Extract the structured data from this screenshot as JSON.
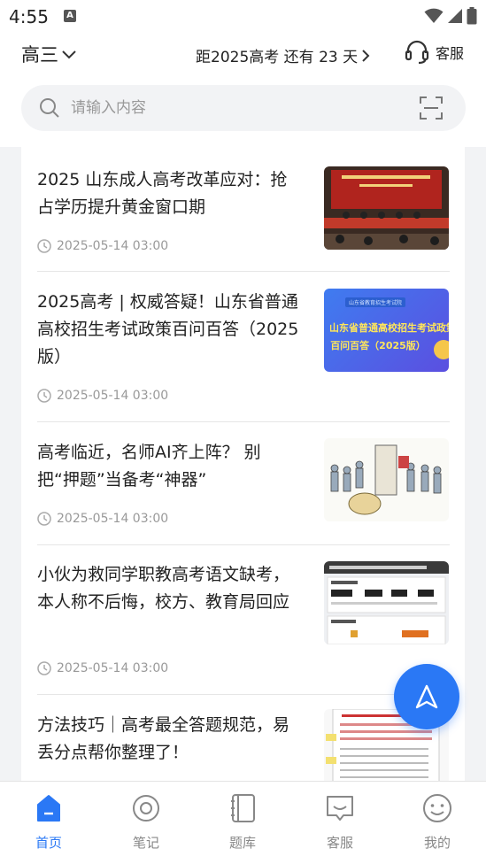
{
  "status": {
    "time": "4:55",
    "notif_letter": "A"
  },
  "header": {
    "grade": "高三",
    "countdown": "距2025高考 还有 23 天",
    "service_label": "客服"
  },
  "search": {
    "placeholder": "请输入内容"
  },
  "articles": [
    {
      "title": "2025 山东成人高考改革应对：抢占学历提升黄金窗口期",
      "date": "2025-05-14 03:00",
      "thumb": "meeting-photo"
    },
    {
      "title": "2025高考 | 权威答疑！山东省普通高校招生考试政策百问百答（2025版）",
      "date": "2025-05-14 03:00",
      "thumb": "policy-banner",
      "thumb_text_small": "山东省教育招生考试院",
      "thumb_text_line1": "山东省普通高校招生考试政策",
      "thumb_text_line2": "百问百答（2025版）"
    },
    {
      "title": "高考临近，名师AI齐上阵？ 别把“押题”当备考“神器”",
      "date": "2025-05-14 03:00",
      "thumb": "cartoon-illustration"
    },
    {
      "title": "小伙为救同学职教高考语文缺考，本人称不后悔，校方、教育局回应",
      "date": "2025-05-14 03:00",
      "thumb": "data-screenshot"
    },
    {
      "title": "方法技巧｜高考最全答题规范，易丢分点帮你整理了！",
      "date": "",
      "thumb": "exam-sheet"
    }
  ],
  "nav": [
    {
      "label": "首页",
      "icon": "home-icon",
      "active": true
    },
    {
      "label": "笔记",
      "icon": "notes-icon",
      "active": false
    },
    {
      "label": "题库",
      "icon": "question-bank-icon",
      "active": false
    },
    {
      "label": "客服",
      "icon": "chat-icon",
      "active": false
    },
    {
      "label": "我的",
      "icon": "profile-icon",
      "active": false
    }
  ],
  "colors": {
    "accent": "#2a78f5",
    "text": "#222222",
    "muted": "#999999",
    "feed_bg": "#f2f3f5"
  }
}
